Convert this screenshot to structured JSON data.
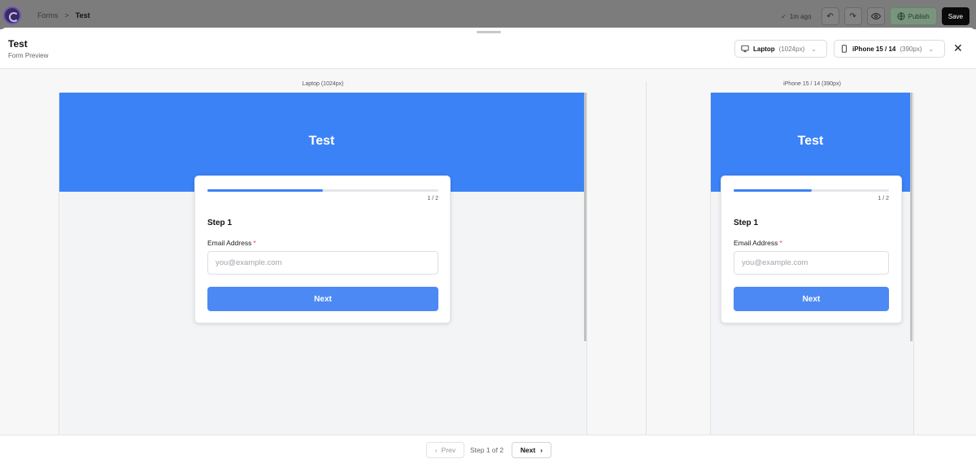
{
  "topbar": {
    "breadcrumb": {
      "parent": "Forms",
      "separator": ">",
      "current": "Test"
    },
    "saved_status": "1m ago",
    "icons": {
      "logo": "app-logo",
      "saved": "check-icon",
      "undo": "undo-icon",
      "redo": "redo-icon",
      "preview": "eye-icon",
      "publish": "globe-icon"
    },
    "publish_label": "Publish",
    "save_label": "Save"
  },
  "preview": {
    "title": "Test",
    "subtitle": "Form Preview",
    "devices": [
      {
        "name": "Laptop",
        "size": "(1024px)",
        "icon": "monitor-icon"
      },
      {
        "name": "iPhone 15 / 14",
        "size": "(390px)",
        "icon": "phone-icon"
      }
    ],
    "close_icon": "close-icon"
  },
  "frames": {
    "laptop_label": "Laptop (1024px)",
    "phone_label": "iPhone 15 / 14 (390px)"
  },
  "form": {
    "title": "Test",
    "progress_text": "1 / 2",
    "progress_fraction": 0.5,
    "step_heading": "Step 1",
    "field_label": "Email Address",
    "required_mark": "*",
    "placeholder": "you@example.com",
    "next_label": "Next"
  },
  "footer": {
    "prev_label": "Prev",
    "step_text": "Step 1 of 2",
    "next_label": "Next"
  },
  "colors": {
    "brand_blue": "#3b82f6",
    "button_blue": "#4c89f5",
    "required_red": "#ef4444",
    "save_black": "#0a0a0a"
  }
}
